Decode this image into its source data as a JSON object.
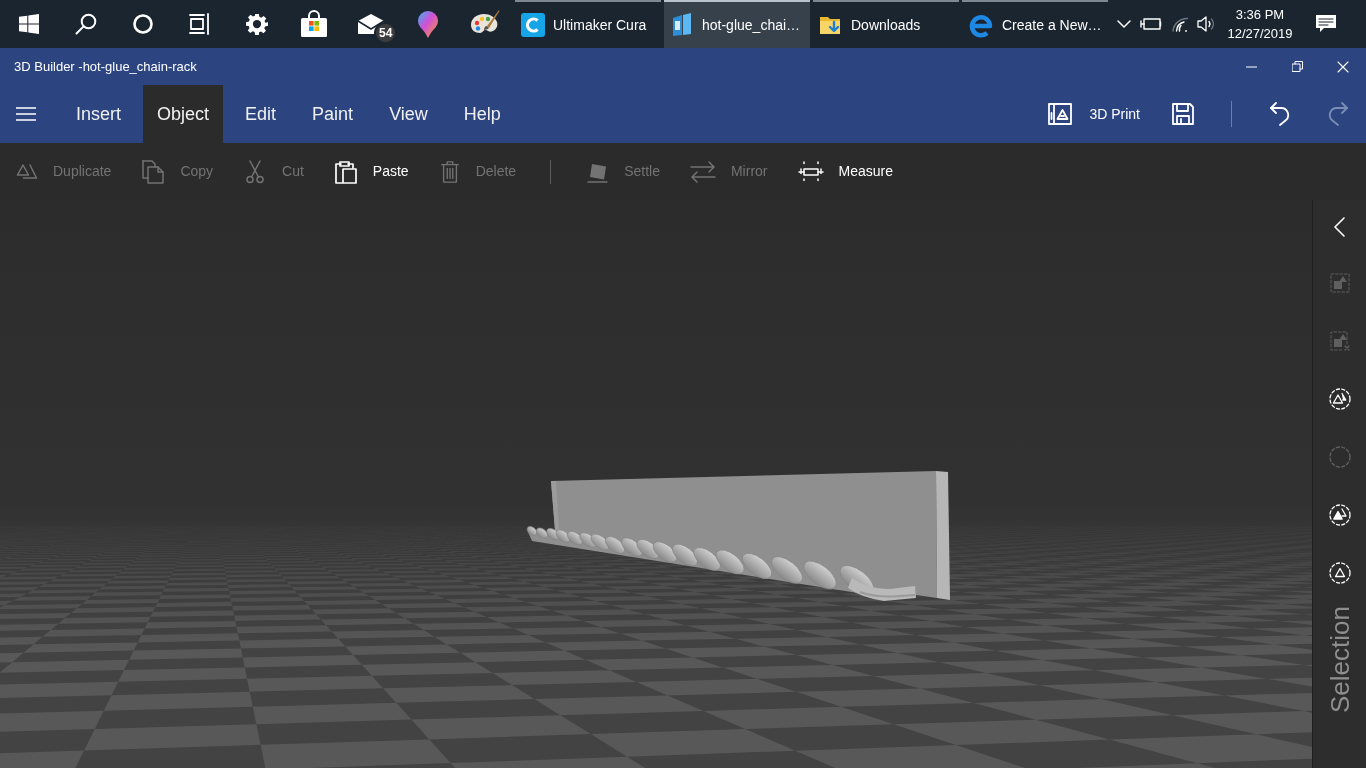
{
  "taskbar": {
    "mail_badge": "54",
    "tasks": [
      {
        "kind": "cura",
        "label": "Ultimaker Cura",
        "selected": false
      },
      {
        "kind": "builder",
        "label": "hot-glue_chai…",
        "selected": true
      },
      {
        "kind": "folder",
        "label": "Downloads",
        "selected": false
      },
      {
        "kind": "browser",
        "label": "Create a New…",
        "selected": false
      }
    ],
    "clock": {
      "time": "3:36 PM",
      "date": "12/27/2019"
    }
  },
  "window": {
    "title": "3D Builder -hot-glue_chain-rack"
  },
  "ribbon": {
    "tabs": [
      {
        "label": "Insert",
        "selected": false
      },
      {
        "label": "Object",
        "selected": true
      },
      {
        "label": "Edit",
        "selected": false
      },
      {
        "label": "Paint",
        "selected": false
      },
      {
        "label": "View",
        "selected": false
      },
      {
        "label": "Help",
        "selected": false
      }
    ],
    "action_groups": [
      [
        {
          "kind": "print",
          "label": "3D Print",
          "disabled": false
        },
        {
          "kind": "save",
          "disabled": false
        }
      ],
      [
        {
          "kind": "undo",
          "disabled": false
        },
        {
          "kind": "redo",
          "disabled": true
        }
      ]
    ]
  },
  "toolbar": {
    "groups": [
      [
        {
          "kind": "duplicate",
          "label": "Duplicate",
          "disabled": true
        },
        {
          "kind": "copy",
          "label": "Copy",
          "disabled": true
        },
        {
          "kind": "cut",
          "label": "Cut",
          "disabled": true
        },
        {
          "kind": "paste",
          "label": "Paste",
          "disabled": false
        },
        {
          "kind": "delete",
          "label": "Delete",
          "disabled": true
        }
      ],
      [
        {
          "kind": "settle",
          "label": "Settle",
          "disabled": true
        },
        {
          "kind": "mirror",
          "label": "Mirror",
          "disabled": true
        },
        {
          "kind": "measure",
          "label": "Measure",
          "disabled": false
        }
      ]
    ]
  },
  "side_panel": {
    "label": "Selection",
    "tools": [
      {
        "kind": "collapse",
        "disabled": false
      },
      {
        "kind": "shapes-square",
        "disabled": true
      },
      {
        "kind": "shapes-square-x",
        "disabled": true
      },
      {
        "kind": "triangles-circle",
        "disabled": false
      },
      {
        "kind": "empty-circle",
        "disabled": true
      },
      {
        "kind": "stacked-triangles-circle",
        "disabled": false
      },
      {
        "kind": "triangle-circle",
        "disabled": false
      }
    ]
  }
}
